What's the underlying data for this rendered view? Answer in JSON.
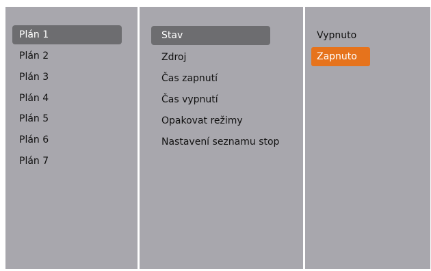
{
  "schedules": {
    "items": [
      {
        "label": "Plán 1"
      },
      {
        "label": "Plán 2"
      },
      {
        "label": "Plán 3"
      },
      {
        "label": "Plán 4"
      },
      {
        "label": "Plán 5"
      },
      {
        "label": "Plán 6"
      },
      {
        "label": "Plán 7"
      }
    ],
    "selected_index": 0
  },
  "settings": {
    "items": [
      {
        "label": "Stav"
      },
      {
        "label": "Zdroj"
      },
      {
        "label": "Čas zapnutí"
      },
      {
        "label": "Čas vypnutí"
      },
      {
        "label": "Opakovat režimy"
      },
      {
        "label": "Nastavení seznamu stop"
      }
    ],
    "selected_index": 0
  },
  "status_options": {
    "items": [
      {
        "label": "Vypnuto"
      },
      {
        "label": "Zapnuto"
      }
    ],
    "selected_index": 1
  },
  "colors": {
    "panel_bg": "#a8a7ad",
    "divider": "#ffffff",
    "selection_gray": "#6d6d70",
    "selection_orange": "#e6731c"
  }
}
